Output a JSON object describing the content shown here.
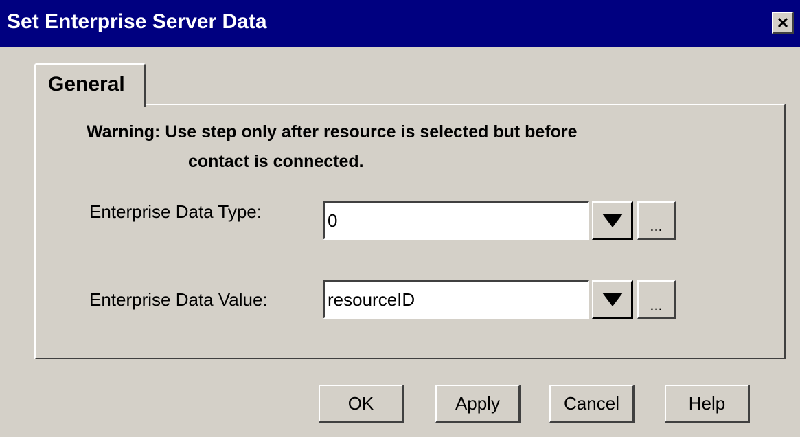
{
  "window": {
    "title": "Set Enterprise Server Data",
    "close_icon": "close-icon"
  },
  "tabs": [
    {
      "label": "General",
      "selected": true
    }
  ],
  "warning": {
    "line1": "Warning: Use step only after resource is selected but before",
    "line2": "contact is connected."
  },
  "fields": [
    {
      "label": "Enterprise Data Type:",
      "value": "0",
      "dropdown_icon": "dropdown-arrow-icon",
      "browse_label": "..."
    },
    {
      "label": "Enterprise Data Value:",
      "value": "resourceID",
      "dropdown_icon": "dropdown-arrow-icon",
      "browse_label": "..."
    }
  ],
  "buttons": {
    "ok": "OK",
    "apply": "Apply",
    "cancel": "Cancel",
    "help": "Help"
  },
  "colors": {
    "titlebar": "#000080",
    "face": "#d4d0c8"
  }
}
